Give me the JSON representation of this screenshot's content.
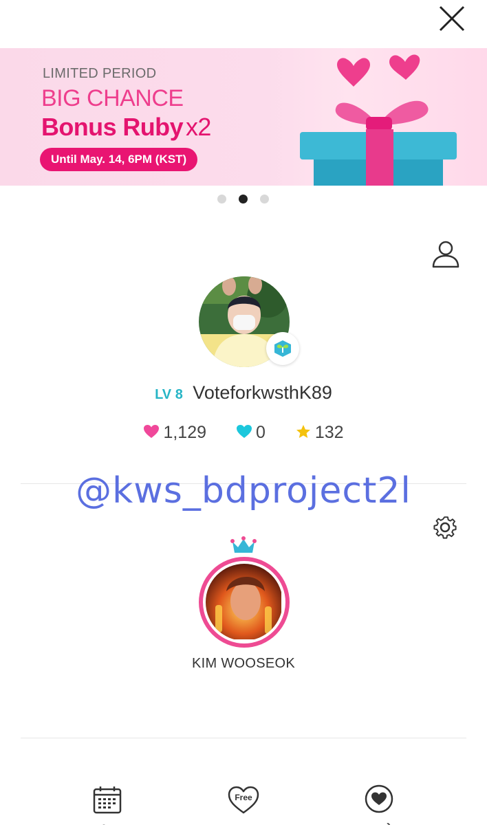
{
  "colors": {
    "accent_pink": "#e4146f",
    "level_teal": "#27b5c6",
    "watermark_blue": "#5b6fe0",
    "heart_pink": "#f0489a",
    "heart_teal": "#1cc7dc",
    "star_gold": "#f4c20d"
  },
  "banner": {
    "kicker": "LIMITED PERIOD",
    "headline": "BIG CHANCE",
    "offer": "Bonus Ruby",
    "multiplier": "x2",
    "deadline": "Until May. 14, 6PM (KST)"
  },
  "carousel": {
    "pages": 3,
    "active_index": 1
  },
  "user": {
    "level": "LV 8",
    "username": "VoteforkwsthK89",
    "stats": {
      "pink_hearts": "1,129",
      "blue_hearts": "0",
      "stars": "132"
    }
  },
  "watermark": "@kws_bdproject2l",
  "idol": {
    "name": "KIM WOOSEOK"
  },
  "bottom_nav": [
    {
      "icon": "calendar-icon"
    },
    {
      "icon": "free-heart-icon",
      "badge": "Free"
    },
    {
      "icon": "heart-circle-icon"
    }
  ]
}
